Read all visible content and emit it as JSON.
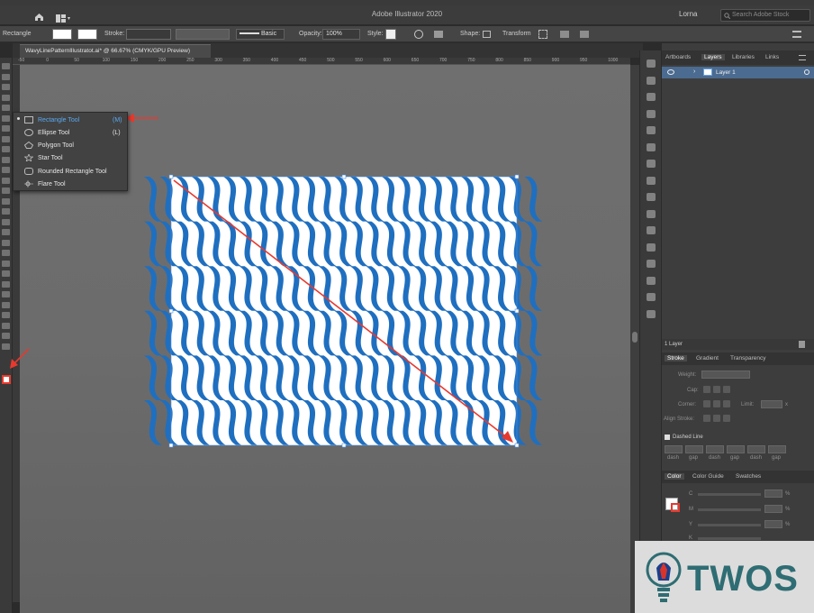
{
  "app": {
    "title": "Adobe Illustrator 2020",
    "user": "Lorna",
    "search_placeholder": "Search Adobe Stock"
  },
  "control_bar": {
    "object_type": "Rectangle",
    "stroke_label": "Stroke:",
    "brush_label": "Basic",
    "opacity_label": "Opacity:",
    "opacity_value": "100%",
    "style_label": "Style:",
    "shape_label": "Shape:",
    "transform_label": "Transform"
  },
  "document": {
    "tab_label": "WavyLinePatternIllustratot.ai* @ 66.67% (CMYK/GPU Preview)",
    "ruler_ticks": [
      "-50",
      "0",
      "50",
      "100",
      "150",
      "200",
      "250",
      "300",
      "350",
      "400",
      "450",
      "500",
      "550",
      "600",
      "650",
      "700",
      "750",
      "800",
      "850",
      "900",
      "950",
      "1000"
    ]
  },
  "flyout": {
    "items": [
      {
        "label": "Rectangle Tool",
        "key": "(M)",
        "selected": true
      },
      {
        "label": "Ellipse Tool",
        "key": "(L)",
        "selected": false
      },
      {
        "label": "Polygon Tool",
        "key": "",
        "selected": false
      },
      {
        "label": "Star Tool",
        "key": "",
        "selected": false
      },
      {
        "label": "Rounded Rectangle Tool",
        "key": "",
        "selected": false
      },
      {
        "label": "Flare Tool",
        "key": "",
        "selected": false
      }
    ]
  },
  "panels": {
    "top_tabs": [
      "Artboards",
      "Layers",
      "Libraries",
      "Links"
    ],
    "layer_name": "Layer 1",
    "layers_count": "1 Layer",
    "stroke_tabs": [
      "Stroke",
      "Gradient",
      "Transparency"
    ],
    "stroke": {
      "weight_label": "Weight:",
      "cap_label": "Cap:",
      "corner_label": "Corner:",
      "limit_label": "Limit:",
      "limit_unit": "x",
      "align_label": "Align Stroke:",
      "dashed_label": "Dashed Line",
      "dash_cells": [
        "dash",
        "gap",
        "dash",
        "gap",
        "dash",
        "gap"
      ]
    },
    "color_tabs": [
      "Color",
      "Color Guide",
      "Swatches"
    ],
    "color_channels": [
      {
        "name": "C",
        "unit": "%"
      },
      {
        "name": "M",
        "unit": "%"
      },
      {
        "name": "Y",
        "unit": "%"
      },
      {
        "name": "K",
        "unit": "%"
      }
    ]
  },
  "watermark": {
    "text": "TWOS"
  },
  "colors": {
    "pattern_blue": "#1f6fc0",
    "annotation_red": "#e8392e",
    "selection_blue": "#4b8fe0"
  }
}
